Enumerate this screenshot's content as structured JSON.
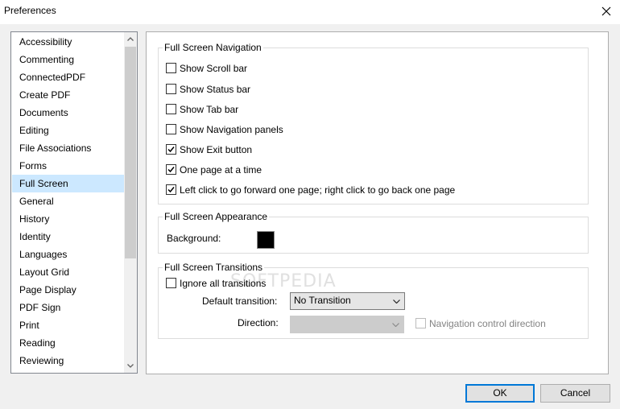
{
  "window": {
    "title": "Preferences",
    "close_icon": "close-icon"
  },
  "sidebar": {
    "items": [
      {
        "label": "Accessibility"
      },
      {
        "label": "Commenting"
      },
      {
        "label": "ConnectedPDF"
      },
      {
        "label": "Create PDF"
      },
      {
        "label": "Documents"
      },
      {
        "label": "Editing"
      },
      {
        "label": "File Associations"
      },
      {
        "label": "Forms"
      },
      {
        "label": "Full Screen",
        "selected": true
      },
      {
        "label": "General"
      },
      {
        "label": "History"
      },
      {
        "label": "Identity"
      },
      {
        "label": "Languages"
      },
      {
        "label": "Layout Grid"
      },
      {
        "label": "Page Display"
      },
      {
        "label": "PDF Sign"
      },
      {
        "label": "Print"
      },
      {
        "label": "Reading"
      },
      {
        "label": "Reviewing"
      }
    ],
    "selected_color": "#cce8ff"
  },
  "navigation": {
    "legend": "Full Screen Navigation",
    "options": [
      {
        "label": "Show Scroll bar",
        "checked": false
      },
      {
        "label": "Show Status bar",
        "checked": false
      },
      {
        "label": "Show Tab bar",
        "checked": false
      },
      {
        "label": "Show Navigation panels",
        "checked": false
      },
      {
        "label": "Show Exit button",
        "checked": true
      },
      {
        "label": "One page at a time",
        "checked": true
      },
      {
        "label": "Left click to go forward one page; right click to go back one page",
        "checked": true
      }
    ]
  },
  "appearance": {
    "legend": "Full Screen Appearance",
    "background_label": "Background:",
    "background_color": "#000000"
  },
  "transitions": {
    "legend": "Full Screen Transitions",
    "ignore_label": "Ignore all transitions",
    "ignore_checked": false,
    "default_label": "Default transition:",
    "default_value": "No Transition",
    "direction_label": "Direction:",
    "direction_value": "",
    "nav_control_label": "Navigation control direction",
    "nav_control_checked": false
  },
  "buttons": {
    "ok": "OK",
    "cancel": "Cancel"
  },
  "watermark": "SOFTPEDIA",
  "colors": {
    "accent": "#0078d7",
    "window_bg": "#f0f0f0"
  }
}
